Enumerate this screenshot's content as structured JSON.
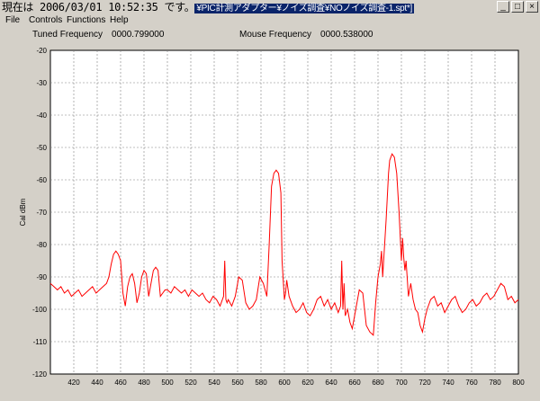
{
  "window": {
    "title_overlay": "現在は 2006/03/01 10:52:35 です。",
    "title_rest": "¥PIC計測アダプター¥ノイズ調査¥NOノイズ調査-1.spt*]",
    "minimize_label": "_",
    "maximize_label": "□",
    "close_label": "×"
  },
  "menu": [
    "File",
    "Controls",
    "Functions",
    "Help"
  ],
  "info": {
    "tuned_label": "Tuned Frequency",
    "tuned_value": "0000.799000",
    "mouse_label": "Mouse Frequency",
    "mouse_value": "0000.538000"
  },
  "colors": {
    "plot_bg": "#ffffff",
    "trace": "#ff0000",
    "grid": "#808080"
  },
  "chart_data": {
    "type": "line",
    "title": "",
    "xlabel": "",
    "ylabel": "Cal dBm",
    "xlim": [
      400,
      800
    ],
    "ylim": [
      -120,
      -20
    ],
    "xticks": [
      420,
      440,
      460,
      480,
      500,
      520,
      540,
      560,
      580,
      600,
      620,
      640,
      660,
      680,
      700,
      720,
      740,
      760,
      780,
      800
    ],
    "yticks": [
      -20,
      -30,
      -40,
      -50,
      -60,
      -70,
      -80,
      -90,
      -100,
      -110,
      -120
    ],
    "grid": true,
    "series": [
      {
        "x": [
          400,
          403,
          406,
          409,
          412,
          415,
          418,
          421,
          424,
          427,
          430,
          433,
          436,
          439,
          442,
          445,
          448,
          450,
          452,
          454,
          456,
          458,
          460,
          462,
          464,
          466,
          468,
          470,
          472,
          474,
          476,
          478,
          480,
          482,
          484,
          486,
          488,
          490,
          492,
          494,
          496,
          498,
          500,
          503,
          506,
          509,
          512,
          515,
          518,
          521,
          524,
          527,
          530,
          533,
          536,
          539,
          542,
          545,
          548,
          549,
          550,
          551,
          552,
          555,
          558,
          561,
          564,
          567,
          570,
          573,
          576,
          579,
          582,
          585,
          587,
          589,
          591,
          593,
          595,
          597,
          598,
          600,
          601,
          602,
          604,
          607,
          610,
          613,
          616,
          619,
          622,
          625,
          628,
          631,
          634,
          637,
          640,
          643,
          646,
          648,
          649,
          650,
          651,
          652,
          654,
          656,
          658,
          661,
          664,
          667,
          670,
          673,
          676,
          678,
          680,
          682,
          683,
          684,
          685,
          686,
          687,
          688,
          689,
          690,
          692,
          694,
          696,
          698,
          700,
          701,
          702,
          703,
          704,
          706,
          708,
          710,
          712,
          714,
          716,
          718,
          720,
          722,
          725,
          728,
          731,
          734,
          737,
          740,
          743,
          746,
          749,
          752,
          755,
          758,
          761,
          764,
          767,
          770,
          773,
          776,
          779,
          782,
          785,
          788,
          791,
          794,
          797,
          800
        ],
        "y": [
          -92,
          -93,
          -94,
          -93,
          -95,
          -94,
          -96,
          -95,
          -94,
          -96,
          -95,
          -94,
          -93,
          -95,
          -94,
          -93,
          -92,
          -90,
          -86,
          -83,
          -82,
          -83,
          -85,
          -95,
          -99,
          -93,
          -90,
          -89,
          -92,
          -98,
          -95,
          -90,
          -88,
          -89,
          -96,
          -92,
          -88,
          -87,
          -88,
          -96,
          -95,
          -94,
          -94,
          -95,
          -93,
          -94,
          -95,
          -94,
          -96,
          -94,
          -95,
          -96,
          -95,
          -97,
          -98,
          -96,
          -97,
          -99,
          -96,
          -85,
          -97,
          -98,
          -97,
          -99,
          -96,
          -90,
          -91,
          -98,
          -100,
          -99,
          -97,
          -90,
          -92,
          -96,
          -80,
          -62,
          -58,
          -57,
          -58,
          -64,
          -85,
          -97,
          -95,
          -91,
          -96,
          -99,
          -101,
          -100,
          -98,
          -101,
          -102,
          -100,
          -97,
          -96,
          -99,
          -97,
          -100,
          -98,
          -101,
          -99,
          -85,
          -100,
          -92,
          -102,
          -100,
          -104,
          -106,
          -100,
          -94,
          -95,
          -105,
          -107,
          -108,
          -98,
          -90,
          -86,
          -82,
          -90,
          -84,
          -78,
          -72,
          -65,
          -58,
          -54,
          -52,
          -53,
          -58,
          -70,
          -85,
          -78,
          -84,
          -88,
          -85,
          -96,
          -92,
          -97,
          -100,
          -101,
          -105,
          -107,
          -103,
          -100,
          -97,
          -96,
          -99,
          -98,
          -101,
          -99,
          -97,
          -96,
          -99,
          -101,
          -100,
          -98,
          -97,
          -99,
          -98,
          -96,
          -95,
          -97,
          -96,
          -94,
          -92,
          -93,
          -97,
          -96,
          -98,
          -97
        ]
      }
    ]
  }
}
